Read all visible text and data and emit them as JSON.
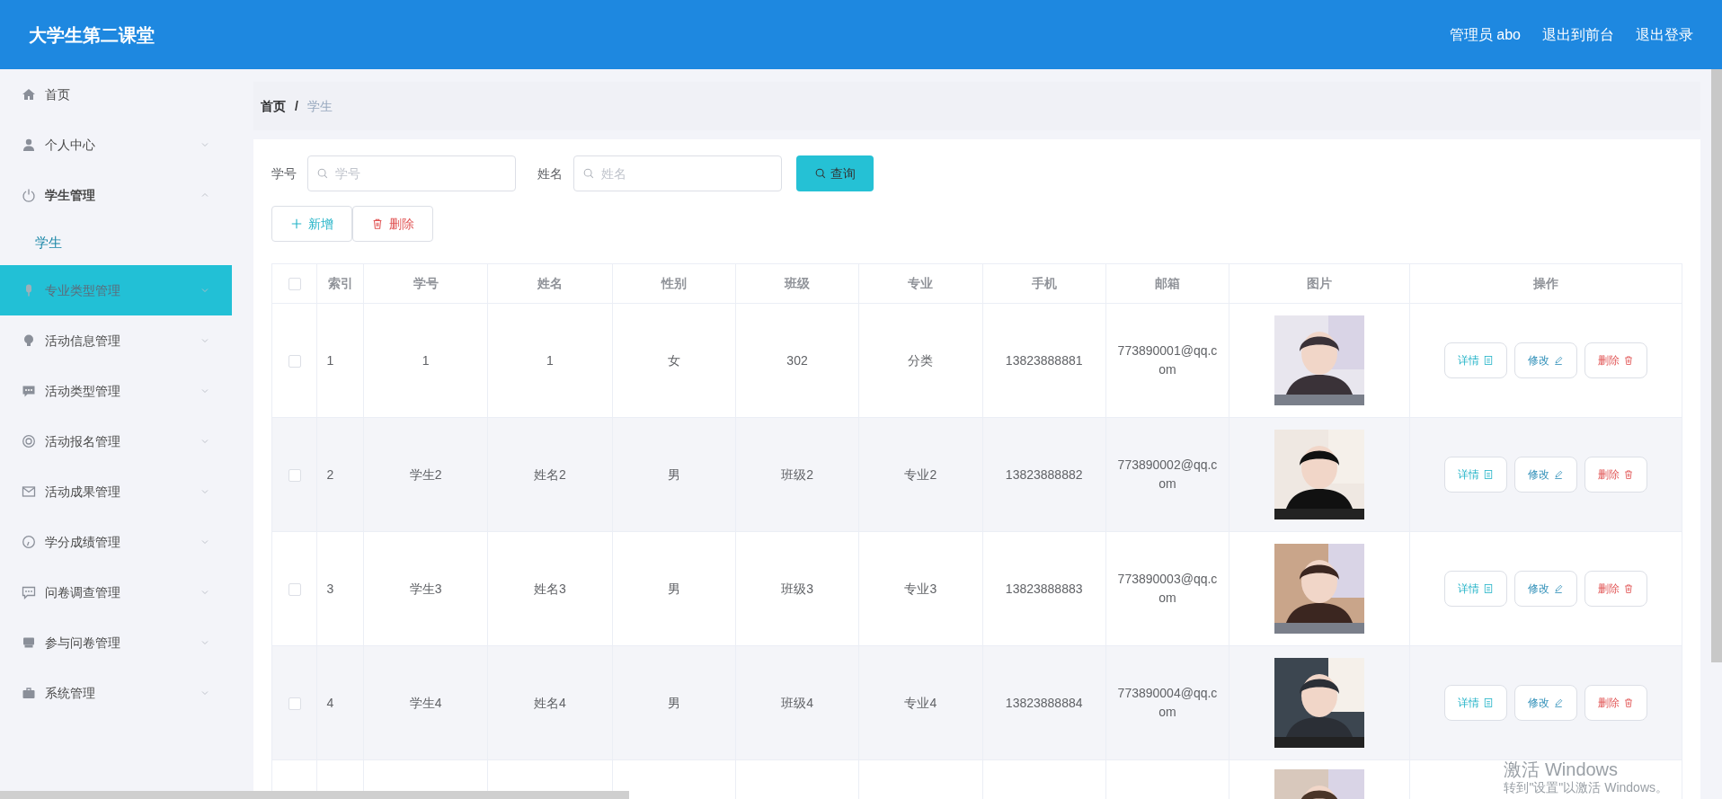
{
  "header": {
    "title": "大学生第二课堂",
    "links": [
      "管理员 abo",
      "退出到前台",
      "退出登录"
    ]
  },
  "sidebar": {
    "items": [
      {
        "label": "首页",
        "kind": "link",
        "hovered": false
      },
      {
        "label": "个人中心",
        "kind": "menu",
        "expanded": false,
        "hovered": false
      },
      {
        "label": "学生管理",
        "kind": "menu",
        "expanded": true,
        "hovered": false,
        "children": [
          {
            "label": "学生",
            "selected": true
          }
        ]
      },
      {
        "label": "专业类型管理",
        "kind": "menu",
        "expanded": false,
        "hovered": true
      },
      {
        "label": "活动信息管理",
        "kind": "menu",
        "expanded": false,
        "hovered": false
      },
      {
        "label": "活动类型管理",
        "kind": "menu",
        "expanded": false,
        "hovered": false
      },
      {
        "label": "活动报名管理",
        "kind": "menu",
        "expanded": false,
        "hovered": false
      },
      {
        "label": "活动成果管理",
        "kind": "menu",
        "expanded": false,
        "hovered": false
      },
      {
        "label": "学分成绩管理",
        "kind": "menu",
        "expanded": false,
        "hovered": false
      },
      {
        "label": "问卷调查管理",
        "kind": "menu",
        "expanded": false,
        "hovered": false
      },
      {
        "label": "参与问卷管理",
        "kind": "menu",
        "expanded": false,
        "hovered": false
      },
      {
        "label": "系统管理",
        "kind": "menu",
        "expanded": false,
        "hovered": false
      }
    ]
  },
  "breadcrumb": {
    "separator": "/",
    "items": [
      "首页",
      "学生"
    ]
  },
  "search": {
    "fields": [
      {
        "label": "学号",
        "placeholder": "学号"
      },
      {
        "label": "姓名",
        "placeholder": "姓名"
      }
    ],
    "button": "查询"
  },
  "toolbar": [
    {
      "label": "新增",
      "kind": "add"
    },
    {
      "label": "删除",
      "kind": "delete"
    }
  ],
  "table": {
    "columns": [
      "索引",
      "学号",
      "姓名",
      "性别",
      "班级",
      "专业",
      "手机",
      "邮箱",
      "图片",
      "操作"
    ],
    "header_checked": false,
    "rows": [
      {
        "checked": false,
        "cells": [
          "1",
          "1",
          "1",
          "女",
          "302",
          "分类",
          "13823888881",
          "773890001@qq.com"
        ],
        "photo": {
          "kind": "picture"
        },
        "actions": [
          {
            "label": "详情",
            "kind": "detail"
          },
          {
            "label": "修改",
            "kind": "edit"
          },
          {
            "label": "删除",
            "kind": "delete"
          }
        ]
      },
      {
        "checked": false,
        "cells": [
          "2",
          "学生2",
          "姓名2",
          "男",
          "班级2",
          "专业2",
          "13823888882",
          "773890002@qq.com"
        ],
        "photo": {
          "kind": "picture"
        },
        "actions": [
          {
            "label": "详情",
            "kind": "detail"
          },
          {
            "label": "修改",
            "kind": "edit"
          },
          {
            "label": "删除",
            "kind": "delete"
          }
        ]
      },
      {
        "checked": false,
        "cells": [
          "3",
          "学生3",
          "姓名3",
          "男",
          "班级3",
          "专业3",
          "13823888883",
          "773890003@qq.com"
        ],
        "photo": {
          "kind": "picture"
        },
        "actions": [
          {
            "label": "详情",
            "kind": "detail"
          },
          {
            "label": "修改",
            "kind": "edit"
          },
          {
            "label": "删除",
            "kind": "delete"
          }
        ]
      },
      {
        "checked": false,
        "cells": [
          "4",
          "学生4",
          "姓名4",
          "男",
          "班级4",
          "专业4",
          "13823888884",
          "773890004@qq.com"
        ],
        "photo": {
          "kind": "picture"
        },
        "actions": [
          {
            "label": "详情",
            "kind": "detail"
          },
          {
            "label": "修改",
            "kind": "edit"
          },
          {
            "label": "删除",
            "kind": "delete"
          }
        ]
      },
      {
        "photo": {
          "kind": "picture"
        }
      }
    ]
  },
  "os_overlay": {
    "title": "激活 Windows",
    "hint": "转到\"设置\"以激活 Windows。"
  }
}
